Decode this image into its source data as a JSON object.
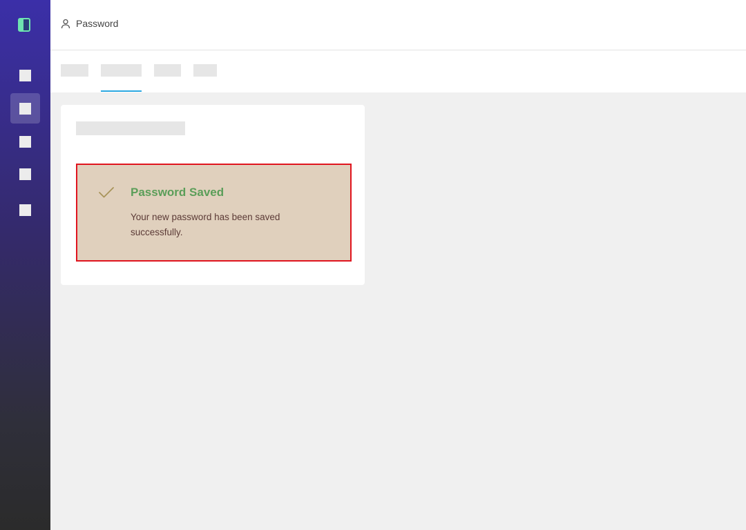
{
  "header": {
    "breadcrumb_icon": "user-icon",
    "breadcrumb_label": "Password"
  },
  "sidebar": {
    "logo_icon": "app-logo-icon",
    "items": [
      {
        "icon": "nav-icon-1",
        "active": false
      },
      {
        "icon": "nav-icon-2",
        "active": true
      },
      {
        "icon": "nav-icon-3",
        "active": false
      },
      {
        "icon": "nav-icon-4",
        "active": false
      },
      {
        "icon": "nav-icon-5",
        "active": false
      }
    ]
  },
  "tabs": {
    "active_index": 1,
    "count": 4
  },
  "alert": {
    "icon": "check-icon",
    "title": "Password Saved",
    "message": "Your new password has been saved successfully."
  },
  "colors": {
    "sidebar_top": "#3b2fa8",
    "sidebar_bottom": "#2b2b2b",
    "logo_accent": "#6ee3b0",
    "tab_active_underline": "#2aa7e0",
    "alert_background": "#e0d0bd",
    "alert_border": "#e0141e",
    "alert_title": "#5b9e59",
    "alert_text": "#5b3a36",
    "check_icon": "#a8945a"
  }
}
